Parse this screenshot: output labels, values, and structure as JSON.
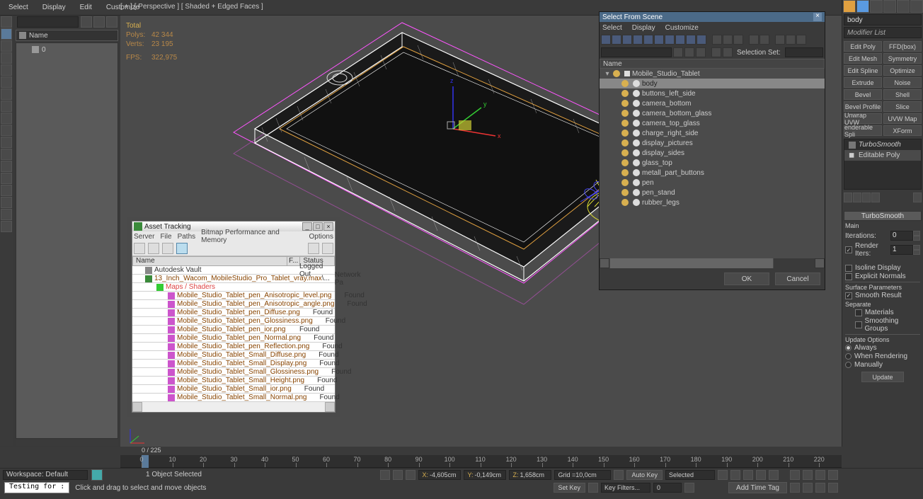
{
  "top_menu": [
    "Select",
    "Display",
    "Edit",
    "Customize"
  ],
  "viewport_label": "[ + ] [ Perspective ] [ Shaded + Edged Faces ]",
  "stats": {
    "total": "Total",
    "polys_lab": "Polys:",
    "polys": "42 344",
    "verts_lab": "Verts:",
    "verts": "23 195",
    "fps_lab": "FPS:",
    "fps": "322,975"
  },
  "left_panel": {
    "name_col": "Name",
    "tree_item": "0"
  },
  "right_panel": {
    "selected": "body",
    "modlist": "Modifier List",
    "btns": [
      "Edit Poly",
      "FFD(box)",
      "Edit Mesh",
      "Symmetry",
      "Edit Spline",
      "Optimize",
      "Extrude",
      "Noise",
      "Bevel",
      "Shell",
      "Bevel Profile",
      "Slice",
      "Unwrap UVW",
      "UVW Map",
      "enderable Spli",
      "XForm"
    ],
    "stack": [
      {
        "t": "TurboSmooth",
        "on": false
      },
      {
        "t": "Editable Poly",
        "on": true
      }
    ],
    "rollout": "TurboSmooth",
    "grp_main": "Main",
    "iterations_lab": "Iterations:",
    "iterations": "0",
    "render_iters_lab": "Render Iters:",
    "render_iters": "1",
    "isoline": "Isoline Display",
    "explicit": "Explicit Normals",
    "grp_surf": "Surface Parameters",
    "smooth_result": "Smooth Result",
    "separate": "Separate",
    "materials": "Materials",
    "smgroups": "Smoothing Groups",
    "grp_upd": "Update Options",
    "always": "Always",
    "when_render": "When Rendering",
    "manually": "Manually",
    "update_btn": "Update"
  },
  "sfs": {
    "title": "Select From Scene",
    "menu": [
      "Select",
      "Display",
      "Customize"
    ],
    "selset": "Selection Set:",
    "name_col": "Name",
    "root": "Mobile_Studio_Tablet",
    "items": [
      "body",
      "buttons_left_side",
      "camera_bottom",
      "camera_bottom_glass",
      "camera_top_glass",
      "charge_right_side",
      "display_pictures",
      "display_sides",
      "glass_top",
      "metall_part_buttons",
      "pen",
      "pen_stand",
      "rubber_legs"
    ],
    "ok": "OK",
    "cancel": "Cancel"
  },
  "asset": {
    "title": "Asset Tracking",
    "menu": [
      "Server",
      "File",
      "Paths",
      "Bitmap Performance and Memory",
      "Options"
    ],
    "cols": [
      "Name",
      "F...",
      "Status"
    ],
    "vault": "Autodesk Vault",
    "scene": "13_Inch_Wacom_MobileStudio_Pro_Tablet_vray.max",
    "scene_f": "\\...",
    "scene_status": "Network Pa",
    "vault_status": "Logged Out",
    "maps": "Maps / Shaders",
    "rows": [
      {
        "n": "Mobile_Studio_Tablet_pen_Anisotropic_level.png",
        "s": "Found"
      },
      {
        "n": "Mobile_Studio_Tablet_pen_Anisotropic_angle.png",
        "s": "Found"
      },
      {
        "n": "Mobile_Studio_Tablet_pen_Diffuse.png",
        "s": "Found"
      },
      {
        "n": "Mobile_Studio_Tablet_pen_Glossiness.png",
        "s": "Found"
      },
      {
        "n": "Mobile_Studio_Tablet_pen_ior.png",
        "s": "Found"
      },
      {
        "n": "Mobile_Studio_Tablet_pen_Normal.png",
        "s": "Found"
      },
      {
        "n": "Mobile_Studio_Tablet_pen_Reflection.png",
        "s": "Found"
      },
      {
        "n": "Mobile_Studio_Tablet_Small_Diffuse.png",
        "s": "Found"
      },
      {
        "n": "Mobile_Studio_Tablet_Small_Display.png",
        "s": "Found"
      },
      {
        "n": "Mobile_Studio_Tablet_Small_Glossiness.png",
        "s": "Found"
      },
      {
        "n": "Mobile_Studio_Tablet_Small_Height.png",
        "s": "Found"
      },
      {
        "n": "Mobile_Studio_Tablet_Small_ior.png",
        "s": "Found"
      },
      {
        "n": "Mobile_Studio_Tablet_Small_Normal.png",
        "s": "Found"
      }
    ]
  },
  "timeline": {
    "frame_info": "0 / 225",
    "ticks": [
      0,
      10,
      20,
      30,
      40,
      50,
      60,
      70,
      80,
      90,
      100,
      110,
      120,
      130,
      140,
      150,
      160,
      170,
      180,
      190,
      200,
      210,
      220
    ]
  },
  "status": {
    "workspace": "Workspace: Default",
    "msg": "1 Object Selected",
    "x_lab": "X:",
    "x": "-4,605cm",
    "y_lab": "Y:",
    "y": "-0,149cm",
    "z_lab": "Z:",
    "z": "1,658cm",
    "grid_lab": "Grid = ",
    "grid": "10,0cm",
    "auto_key": "Auto Key",
    "set_key": "Set Key",
    "selected_dd": "Selected",
    "key_filters": "Key Filters...",
    "testing": "Testing for :",
    "prompt": "Click and drag to select and move objects",
    "add_time_tag": "Add Time Tag"
  }
}
